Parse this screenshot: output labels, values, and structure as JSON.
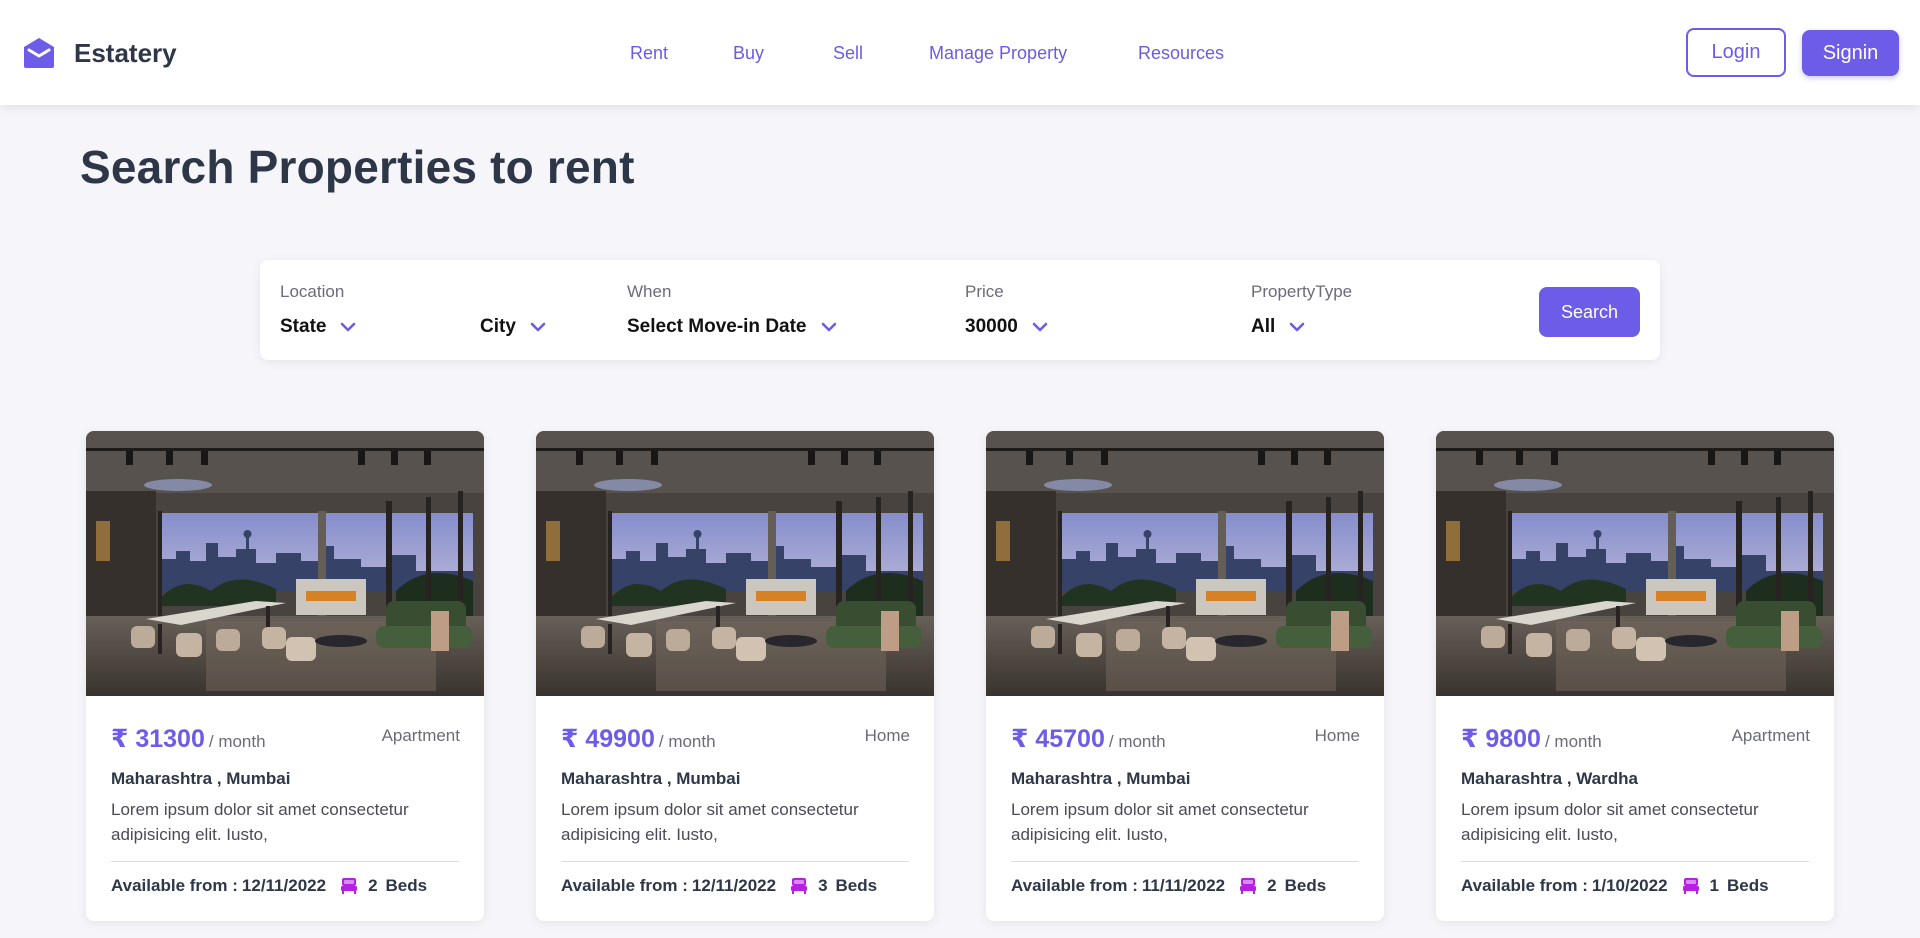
{
  "brand": {
    "name": "Estatery",
    "icon": "envelope-logo-icon"
  },
  "nav": {
    "links": [
      "Rent",
      "Buy",
      "Sell",
      "Manage Property",
      "Resources"
    ],
    "login_label": "Login",
    "signin_label": "Signin"
  },
  "page": {
    "title": "Search Properties to rent"
  },
  "search": {
    "location_label": "Location",
    "state_value": "State",
    "city_value": "City",
    "when_label": "When",
    "when_value": "Select Move-in Date",
    "price_label": "Price",
    "price_value": "30000",
    "type_label": "PropertyType",
    "type_value": "All",
    "button_label": "Search"
  },
  "colors": {
    "accent": "#6c5ce7",
    "bed_icon": "#b620e0",
    "background": "#f6f6fa"
  },
  "listings": [
    {
      "price": "₹ 31300",
      "per": "/ month",
      "type": "Apartment",
      "location": "Maharashtra , Mumbai",
      "description": "Lorem ipsum dolor sit amet consectetur adipisicing elit. Iusto,",
      "available_label": "Available from :",
      "available_date": "12/11/2022",
      "beds": "2",
      "beds_label": "Beds"
    },
    {
      "price": "₹ 49900",
      "per": "/ month",
      "type": "Home",
      "location": "Maharashtra , Mumbai",
      "description": "Lorem ipsum dolor sit amet consectetur adipisicing elit. Iusto,",
      "available_label": "Available from :",
      "available_date": "12/11/2022",
      "beds": "3",
      "beds_label": "Beds"
    },
    {
      "price": "₹ 45700",
      "per": "/ month",
      "type": "Home",
      "location": "Maharashtra , Mumbai",
      "description": "Lorem ipsum dolor sit amet consectetur adipisicing elit. Iusto,",
      "available_label": "Available from :",
      "available_date": "11/11/2022",
      "beds": "2",
      "beds_label": "Beds"
    },
    {
      "price": "₹ 9800",
      "per": "/ month",
      "type": "Apartment",
      "location": "Maharashtra , Wardha",
      "description": "Lorem ipsum dolor sit amet consectetur adipisicing elit. Iusto,",
      "available_label": "Available from :",
      "available_date": "1/10/2022",
      "beds": "1",
      "beds_label": "Beds"
    }
  ]
}
